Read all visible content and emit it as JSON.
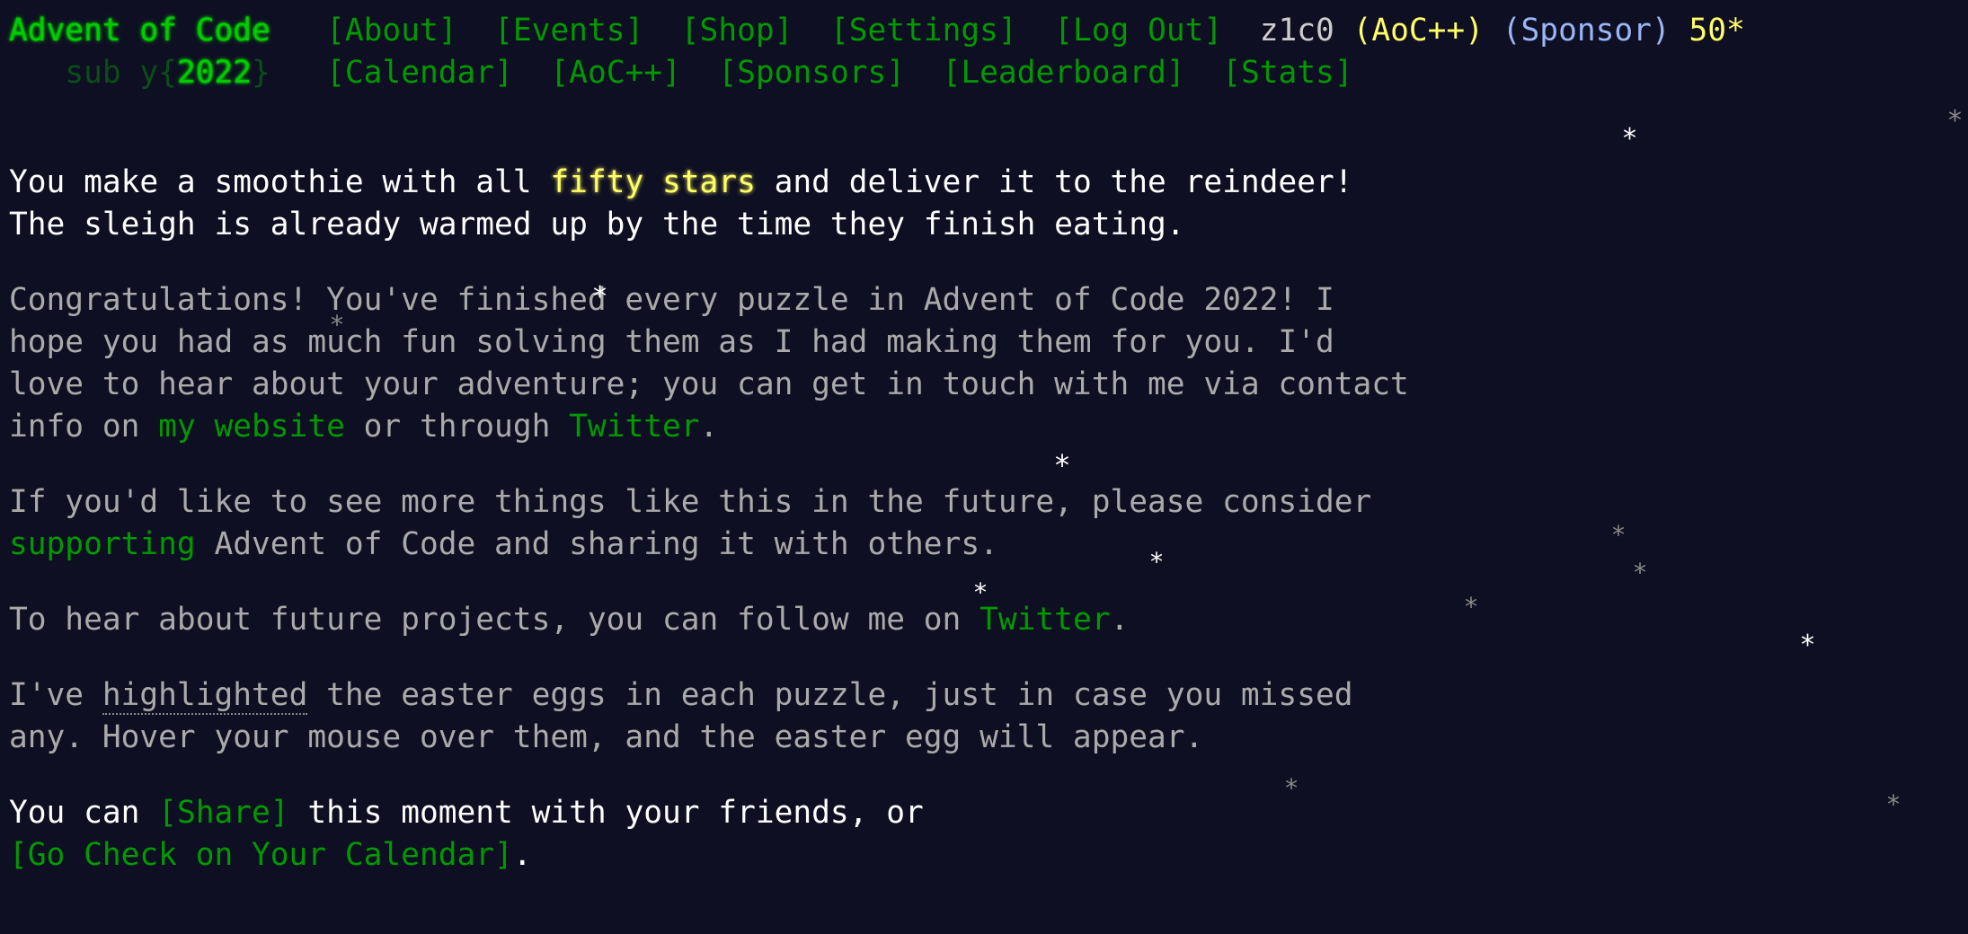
{
  "header": {
    "title": "Advent of Code",
    "nav_top": [
      "[About]",
      "[Events]",
      "[Shop]",
      "[Settings]",
      "[Log Out]"
    ],
    "user": {
      "name": "z1c0",
      "aocpp": "(AoC++)",
      "sponsor": "(Sponsor)",
      "stars": "50*"
    },
    "year_prefix": "sub y",
    "year_open": "{",
    "year": "2022",
    "year_close": "}",
    "nav_bottom": [
      "[Calendar]",
      "[AoC++]",
      "[Sponsors]",
      "[Leaderboard]",
      "[Stats]"
    ]
  },
  "content": {
    "p1": {
      "a": "You make a smoothie with all ",
      "gold": "fifty stars",
      "b": " and deliver it to the reindeer!",
      "c": "The sleigh is already warmed up by the time they finish eating."
    },
    "p2": {
      "line1": "Congratulations! You've finished every puzzle in Advent of Code 2022! I",
      "line2": "hope you had as much fun solving them as I had making them for you. I'd",
      "line3": "love to hear about your adventure; you can get in touch with me via contact",
      "line4_a": "info on ",
      "link_website": "my website",
      "line4_b": " or through ",
      "link_twitter": "Twitter",
      "line4_c": "."
    },
    "p3": {
      "line1": "If you'd like to see more things like this in the future, please consider",
      "link_supporting": "supporting",
      "line2_b": " Advent of Code and sharing it with others."
    },
    "p4": {
      "a": "To hear about future projects, you can follow me on ",
      "link_twitter": "Twitter",
      "b": "."
    },
    "p5": {
      "a": "I've ",
      "highlighted": "highlighted",
      "b": " the easter eggs in each puzzle, just in case you missed",
      "line2": "any. Hover your mouse over them, and the easter egg will appear."
    },
    "p6": {
      "a": "You can ",
      "share": "[Share]",
      "b": " this moment with your friends, or",
      "calendar": "[Go Check on Your Calendar]",
      "c": "."
    }
  },
  "stars": {
    "glyph": "*",
    "color_bright": "#ffffff",
    "color_dim": "#888888"
  }
}
